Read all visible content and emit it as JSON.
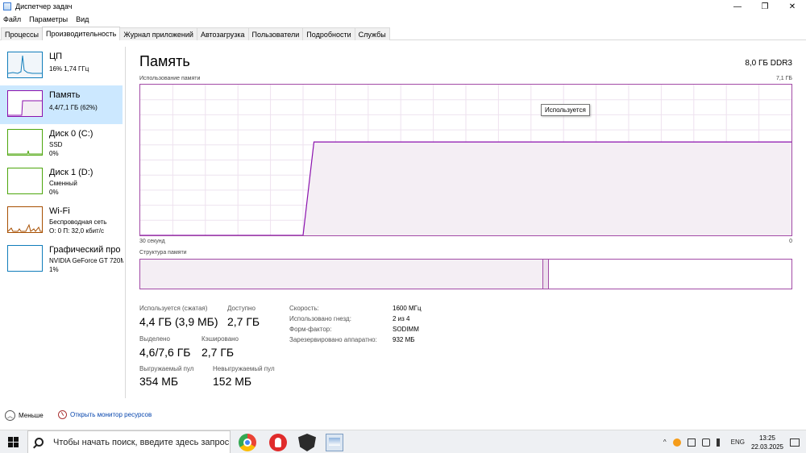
{
  "window": {
    "title": "Диспетчер задач",
    "controls": {
      "minimize": "—",
      "maximize": "❐",
      "close": "✕"
    }
  },
  "menu": [
    "Файл",
    "Параметры",
    "Вид"
  ],
  "tabs": [
    {
      "label": "Процессы",
      "active": false
    },
    {
      "label": "Производительность",
      "active": true
    },
    {
      "label": "Журнал приложений",
      "active": false
    },
    {
      "label": "Автозагрузка",
      "active": false
    },
    {
      "label": "Пользователи",
      "active": false
    },
    {
      "label": "Подробности",
      "active": false
    },
    {
      "label": "Службы",
      "active": false
    }
  ],
  "sidebar": {
    "items": [
      {
        "name": "ЦП",
        "sub1": "16% 1,74 ГГц",
        "sub2": "",
        "sub3": "",
        "color": "#117dbb"
      },
      {
        "name": "Память",
        "sub1": "4,4/7,1 ГБ (62%)",
        "sub2": "",
        "sub3": "",
        "color": "#8b12ae",
        "selected": true
      },
      {
        "name": "Диск 0 (C:)",
        "sub1": "SSD",
        "sub2": "0%",
        "sub3": "",
        "color": "#4da60c"
      },
      {
        "name": "Диск 1 (D:)",
        "sub1": "Сменный",
        "sub2": "0%",
        "sub3": "",
        "color": "#4da60c"
      },
      {
        "name": "Wi-Fi",
        "sub1": "Беспроводная сеть",
        "sub2": "О: 0 П: 32,0 кбит/с",
        "sub3": "",
        "color": "#a74f01"
      },
      {
        "name": "Графический про",
        "sub1": "NVIDIA GeForce GT 720M",
        "sub2": "1%",
        "sub3": "",
        "color": "#117dbb"
      }
    ]
  },
  "main": {
    "title": "Память",
    "memory_type": "8,0 ГБ DDR3",
    "usage_label": "Использование памяти",
    "usage_max": "7,1 ГБ",
    "time_left": "30 секунд",
    "time_right": "0",
    "tooltip": "Используется",
    "structure_label": "Структура памяти"
  },
  "stats": {
    "in_use_label": "Используется (сжатая)",
    "in_use_value": "4,4 ГБ (3,9 МБ)",
    "available_label": "Доступно",
    "available_value": "2,7 ГБ",
    "committed_label": "Выделено",
    "committed_value": "4,6/7,6 ГБ",
    "cached_label": "Кэшировано",
    "cached_value": "2,7 ГБ",
    "paged_label": "Выгружаемый пул",
    "paged_value": "354 МБ",
    "nonpaged_label": "Невыгружаемый пул",
    "nonpaged_value": "152 МБ"
  },
  "details": [
    {
      "label": "Скорость:",
      "value": "1600 МГц"
    },
    {
      "label": "Использовано гнезд:",
      "value": "2 из 4"
    },
    {
      "label": "Форм-фактор:",
      "value": "SODIMM"
    },
    {
      "label": "Зарезервировано аппаратно:",
      "value": "932 МБ"
    }
  ],
  "footer": {
    "fewer": "Меньше",
    "resmon": "Открыть монитор ресурсов"
  },
  "taskbar": {
    "search_placeholder": "Чтобы начать поиск, введите здесь запрос",
    "lang": "ENG",
    "time": "13:25",
    "date": "22.03.2025",
    "chevron": "^"
  },
  "chart_data": {
    "type": "area",
    "x_label_left": "30 секунд",
    "x_label_right": "0",
    "y_max_label": "7,1 ГБ",
    "x": [
      60,
      50,
      45,
      44,
      43,
      40,
      30,
      20,
      10,
      0
    ],
    "values": [
      0,
      0,
      0,
      4.4,
      4.4,
      4.4,
      4.4,
      4.4,
      4.4,
      4.4
    ],
    "ylim": [
      0,
      7.1
    ],
    "grid": true,
    "color": "#8b12ae"
  }
}
